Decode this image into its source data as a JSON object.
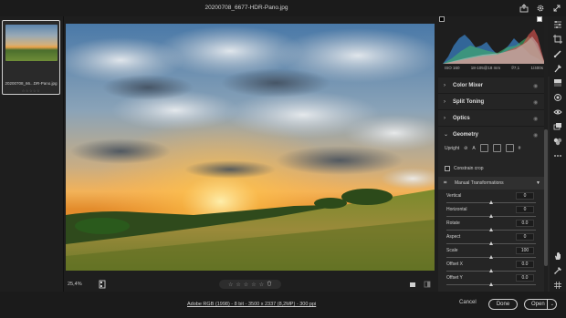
{
  "window": {
    "title": "20200708_6677-HDR-Pano.jpg"
  },
  "filmstrip": {
    "items": [
      {
        "name": "20200708_66...DR-Pano.jpg",
        "stars": "☆☆☆☆☆"
      }
    ]
  },
  "viewer": {
    "zoom": "25,4%",
    "rating_stars": [
      "☆",
      "☆",
      "☆",
      "☆",
      "☆"
    ],
    "delete_icon": "trash-icon"
  },
  "histogram": {
    "exif": {
      "iso": "ISO 160",
      "lens": "18-105@18 mm",
      "aperture": "f/7,1",
      "shutter": "1/400s"
    }
  },
  "panel": {
    "sections": [
      {
        "label": "Color Mixer",
        "open": false
      },
      {
        "label": "Split Toning",
        "open": false
      },
      {
        "label": "Optics",
        "open": false
      },
      {
        "label": "Geometry",
        "open": true
      }
    ],
    "upright_label": "Upright",
    "constrain_crop": "Constrain crop",
    "manual": {
      "label": "Manual Transformations"
    },
    "sliders": [
      {
        "label": "Vertical",
        "value": "0",
        "pos": 0.5
      },
      {
        "label": "Horizontal",
        "value": "0",
        "pos": 0.5
      },
      {
        "label": "Rotate",
        "value": "0.0",
        "pos": 0.5
      },
      {
        "label": "Aspect",
        "value": "0",
        "pos": 0.5
      },
      {
        "label": "Scale",
        "value": "100",
        "pos": 0.5
      },
      {
        "label": "Offset X",
        "value": "0.0",
        "pos": 0.5
      },
      {
        "label": "Offset Y",
        "value": "0.0",
        "pos": 0.5
      }
    ]
  },
  "footer": {
    "file_info": "Adobe RGB (1998) - 8 bit - 3500 x 2337 (8,2MP) - 300 ppi",
    "cancel": "Cancel",
    "done": "Done",
    "open": "Open"
  },
  "colors": {
    "accent": "#1473e6",
    "panel": "#252525",
    "background": "#1e1e1e"
  }
}
